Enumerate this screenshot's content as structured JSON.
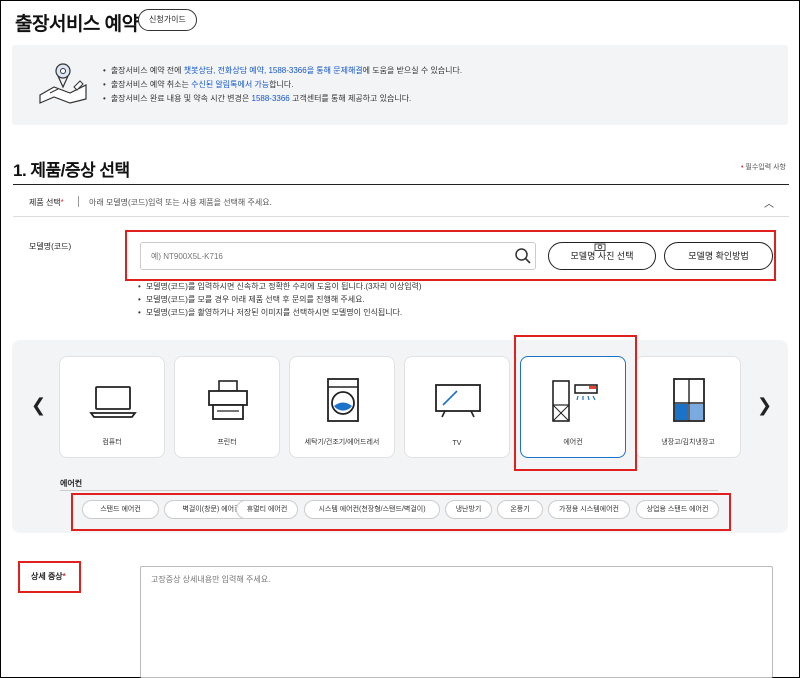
{
  "header": {
    "title": "출장서비스 예약",
    "guide_label": "신청가이드"
  },
  "notice": {
    "line1_pre": "출장서비스 예약 전에 ",
    "line1_hl": "챗봇상담, 전화상담 예약, 1588-3366을 통해 문제해결",
    "line1_post": "에 도움을 받으실 수 있습니다.",
    "line2_pre": "출장서비스 예약 취소는 ",
    "line2_hl": "수신된 알림톡에서 가능",
    "line2_post": "합니다.",
    "line3_pre": "출장서비스 완료 내용 및 약속 시간 변경은 ",
    "line3_hl": "1588-3366",
    "line3_post": " 고객센터를 통해 제공하고 있습니다."
  },
  "section": {
    "title": "1. 제품/증상 선택",
    "required_note": "필수입력 사항"
  },
  "product": {
    "label": "제품 선택",
    "desc": "아래 모델명(코드)입력 또는 사용 제품을 선택해 주세요."
  },
  "model": {
    "label": "모델명(코드)",
    "placeholder": "예) NT900X5L-K716",
    "photo_btn": "모델명 사진 선택",
    "how_btn": "모델명 확인방법",
    "tips": [
      "모델명(코드)를 입력하시면 신속하고 정확한 수리에 도움이 됩니다.(3자리 이상입력)",
      "모델명(코드)를 모를 경우 아래 제품 선택 후 문의를 진행해 주세요.",
      "모델명(코드)을 촬영하거나 저장된 이미지를 선택하시면 모델명이 인식됩니다."
    ]
  },
  "categories": [
    {
      "label": "컴퓨터",
      "icon": "laptop-icon"
    },
    {
      "label": "프린터",
      "icon": "printer-icon"
    },
    {
      "label": "세탁기/건조기/에어드레서",
      "icon": "washer-icon"
    },
    {
      "label": "TV",
      "icon": "tv-icon"
    },
    {
      "label": "에어컨",
      "icon": "air-conditioner-icon"
    },
    {
      "label": "냉장고/김치냉장고",
      "icon": "refrigerator-icon"
    }
  ],
  "selected_category": "에어컨",
  "subcategory": {
    "title": "에어컨",
    "chips": [
      "스탠드 에어컨",
      "벽걸이(창문) 에어컨",
      "휴멀티 에어컨",
      "시스템 에어컨(천장형/스탠드/벽걸이)",
      "냉난방기",
      "온풍기",
      "가정용 시스템에어컨",
      "상업용 스탠드 에어컨"
    ]
  },
  "symptom": {
    "label": "상세 증상",
    "placeholder": "고장증상 상세내용만 입력해 주세요."
  },
  "colors": {
    "highlight": "#1255c8",
    "required": "#d92e2e",
    "annotation": "#e01f1f",
    "selected": "#1a73c9"
  }
}
